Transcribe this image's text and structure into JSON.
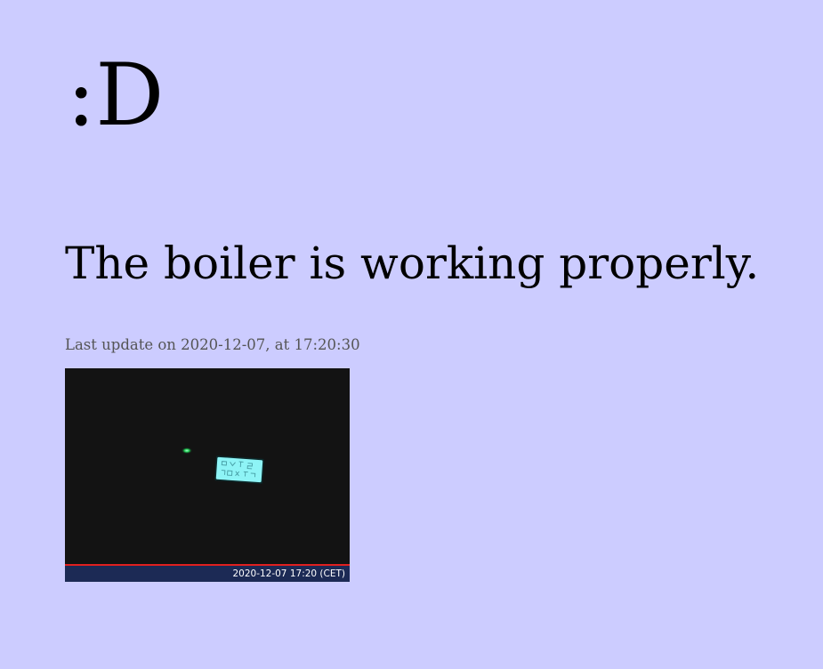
{
  "page": {
    "background_color": "#ccccff",
    "smiley": ":D",
    "status_message": "The boiler is working properly.",
    "last_update": "Last update on 2020-12-07, at 17:20:30"
  },
  "snapshot": {
    "timestamp": "2020-12-07 17:20 (CET)",
    "indicator_led_color": "#22cc55",
    "display_color": "#8ef4f6"
  }
}
